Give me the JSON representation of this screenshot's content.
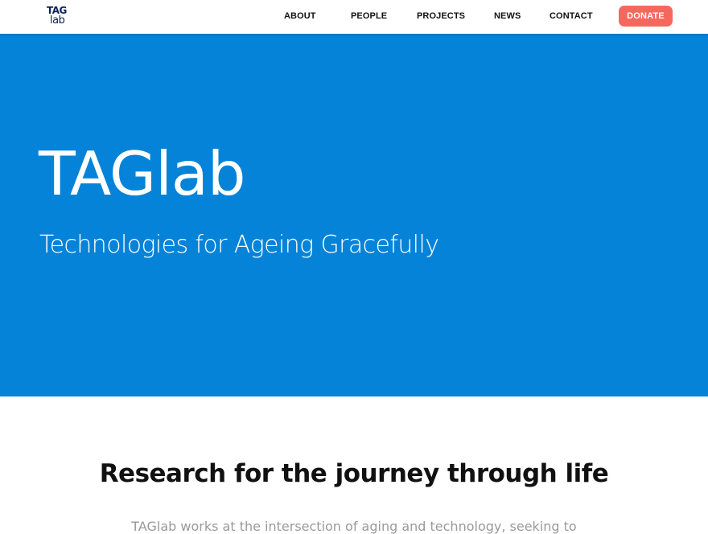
{
  "brand": {
    "logo_line1": "TAG",
    "logo_line2": "lab"
  },
  "nav": {
    "items": [
      {
        "label": "ABOUT"
      },
      {
        "label": "PEOPLE"
      },
      {
        "label": "PROJECTS"
      },
      {
        "label": "NEWS"
      },
      {
        "label": "CONTACT"
      }
    ],
    "donate_label": "DONATE"
  },
  "hero": {
    "title": "TAGlab",
    "subtitle": "Technologies for Ageing Gracefully"
  },
  "intro": {
    "heading": "Research for the journey through life",
    "text": "TAGlab works at the intersection of aging and technology, seeking to"
  },
  "colors": {
    "hero_background": "#0583d8",
    "donate_background": "#f6685e",
    "logo": "#0b1f5c"
  }
}
